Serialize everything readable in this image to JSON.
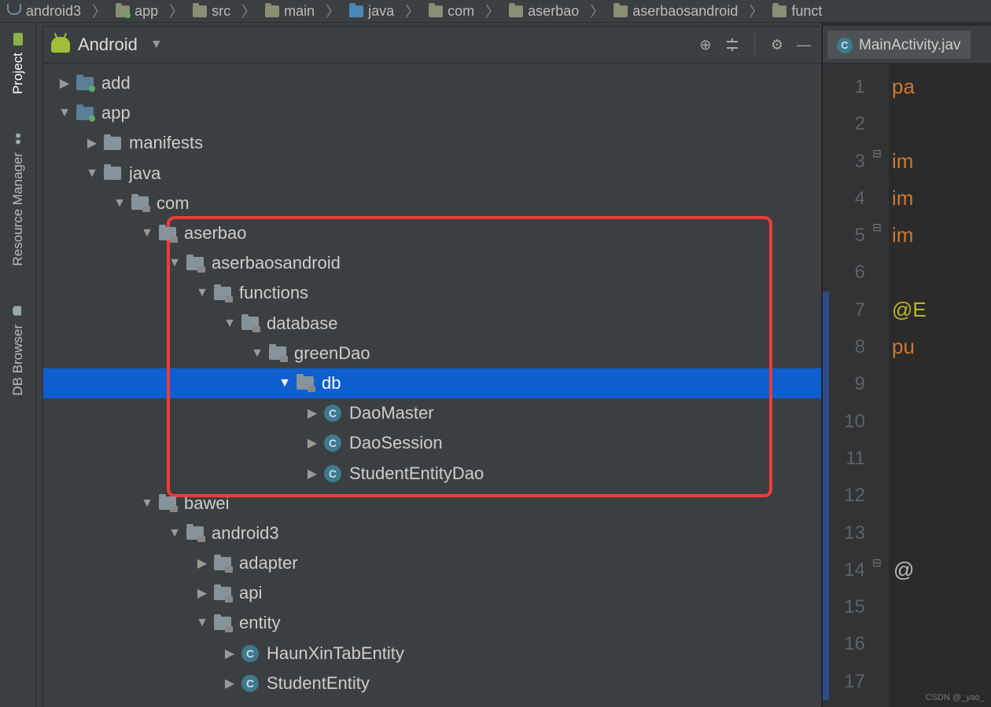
{
  "breadcrumb": [
    "android3",
    "app",
    "src",
    "main",
    "java",
    "com",
    "aserbao",
    "aserbaosandroid",
    "funct"
  ],
  "panel": {
    "view": "Android"
  },
  "sidebar": {
    "project": "Project",
    "resmgr": "Resource Manager",
    "dbbrowser": "DB Browser"
  },
  "tree": [
    {
      "d": 0,
      "i": "mod",
      "a": "right",
      "t": "add",
      "dot": true
    },
    {
      "d": 0,
      "i": "mod",
      "a": "down",
      "t": "app",
      "dot": true
    },
    {
      "d": 1,
      "i": "fld",
      "a": "right",
      "t": "manifests"
    },
    {
      "d": 1,
      "i": "fld",
      "a": "down",
      "t": "java"
    },
    {
      "d": 2,
      "i": "pkg",
      "a": "down",
      "t": "com"
    },
    {
      "d": 3,
      "i": "pkg",
      "a": "down",
      "t": "aserbao"
    },
    {
      "d": 4,
      "i": "pkg",
      "a": "down",
      "t": "aserbaosandroid"
    },
    {
      "d": 5,
      "i": "pkg",
      "a": "down",
      "t": "functions"
    },
    {
      "d": 6,
      "i": "pkg",
      "a": "down",
      "t": "database"
    },
    {
      "d": 7,
      "i": "pkg",
      "a": "down",
      "t": "greenDao"
    },
    {
      "d": 8,
      "i": "pkg",
      "a": "down",
      "t": "db",
      "sel": true
    },
    {
      "d": 9,
      "i": "cls",
      "a": "right",
      "t": "DaoMaster"
    },
    {
      "d": 9,
      "i": "cls",
      "a": "right",
      "t": "DaoSession"
    },
    {
      "d": 9,
      "i": "cls",
      "a": "right",
      "t": "StudentEntityDao"
    },
    {
      "d": 3,
      "i": "pkg",
      "a": "down",
      "t": "bawei"
    },
    {
      "d": 4,
      "i": "pkg",
      "a": "down",
      "t": "android3"
    },
    {
      "d": 5,
      "i": "pkg",
      "a": "right",
      "t": "adapter"
    },
    {
      "d": 5,
      "i": "pkg",
      "a": "right",
      "t": "api"
    },
    {
      "d": 5,
      "i": "pkg",
      "a": "down",
      "t": "entity"
    },
    {
      "d": 6,
      "i": "cls",
      "a": "right",
      "t": "HaunXinTabEntity"
    },
    {
      "d": 6,
      "i": "cls",
      "a": "right",
      "t": "StudentEntity"
    }
  ],
  "icons": {
    "chevRight": "▶",
    "chevDown": "▼",
    "dd": "▼",
    "target": "⊕",
    "collapse": "⇵",
    "gear": "⚙",
    "hide": "—",
    "at": "@",
    "sepChev": "〉"
  },
  "tab": {
    "name": "MainActivity.jav"
  },
  "gutter": [
    "1",
    "2",
    "3",
    "4",
    "5",
    "6",
    "7",
    "8",
    "9",
    "10",
    "11",
    "12",
    "13",
    "14",
    "15",
    "16",
    "17"
  ],
  "code": {
    "l1": "pa",
    "l3": "im",
    "l4": "im",
    "l5": "im",
    "l7": "@E",
    "l8": "pu",
    "l14": "@"
  },
  "watermark": "CSDN @_yao_"
}
